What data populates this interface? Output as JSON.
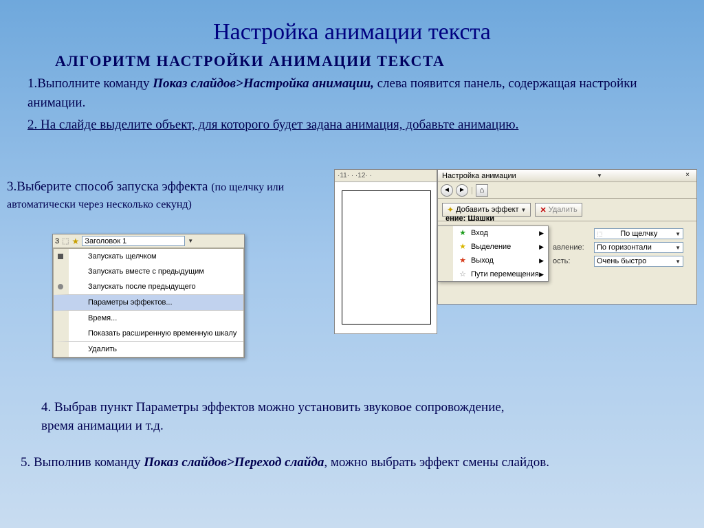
{
  "title": "Настройка анимации текста",
  "subtitle": "АЛГОРИТМ НАСТРОЙКИ АНИМАЦИИ ТЕКСТА",
  "step1": {
    "prefix": "1.Выполните команду ",
    "bold": "Показ слайдов>Настройка анимации,",
    "suffix": " слева появится панель, содержащая настройки анимации."
  },
  "step2": "2. На слайде выделите объект, для которого будет задана анимация, добавьте анимацию.",
  "step3": {
    "line1": "3.Выберите способ запуска эффекта ",
    "small": "(по щелчку или автоматически через несколько секунд)"
  },
  "step4": "4. Выбрав пункт Параметры эффектов можно установить звуковое сопровождение, время анимации и т.д.",
  "step5": {
    "prefix": "5. Выполнив команду ",
    "bold": "Показ слайдов>Переход слайда",
    "suffix": ", можно выбрать эффект смены слайдов."
  },
  "panel_left": {
    "header_num": "3",
    "header_text": "Заголовок 1",
    "items": [
      "Запускать щелчком",
      "Запускать вместе с предыдущим",
      "Запускать после предыдущего",
      "Параметры эффектов...",
      "Время...",
      "Показать расширенную временную шкалу",
      "Удалить"
    ]
  },
  "panel_right": {
    "ruler": "·11· · ·12· ·",
    "title": "Настройка анимации",
    "close": "×",
    "add_effect": "Добавить эффект",
    "dropdown_arrow": "▼",
    "delete_btn": "Удалить",
    "modification_label": "ение: Шашки",
    "effects": [
      "Вход",
      "Выделение",
      "Выход",
      "Пути перемещения"
    ],
    "fields": [
      {
        "label": "",
        "value": "По щелчку"
      },
      {
        "label": "авление:",
        "value": "По горизонтали"
      },
      {
        "label": "ость:",
        "value": "Очень быстро"
      }
    ],
    "nav": {
      "back": "◄",
      "fwd": "►",
      "home": "⌂"
    }
  }
}
